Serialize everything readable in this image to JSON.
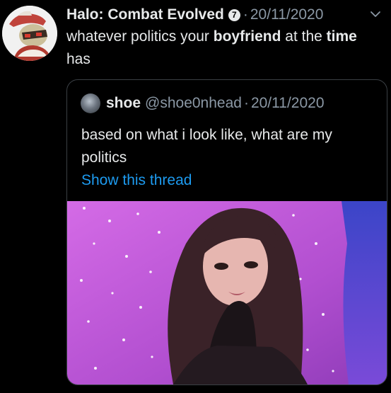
{
  "tweet": {
    "author_name": "Halo: Combat Evolved",
    "badge_glyph": "7",
    "separator": "·",
    "date": "20/11/2020",
    "text_part1": "whatever politics your ",
    "text_bold": "boyfriend",
    "text_part2": " at the ",
    "text_bold2": "time",
    "text_part3": " has",
    "icons": {
      "avatar": "avatar-image",
      "badge": "badge-icon",
      "more": "chevron-down-icon"
    }
  },
  "quoted_tweet": {
    "name": "shoe",
    "handle": "@shoe0nhead",
    "separator": "·",
    "date": "20/11/2020",
    "text": "based on what i look like, what are my politics",
    "thread_link": "Show this thread"
  },
  "colors": {
    "background": "#000000",
    "text": "#e7e9ea",
    "muted": "#8b98a5",
    "link": "#1d9bf0",
    "media_bg": "#c65fd8"
  }
}
